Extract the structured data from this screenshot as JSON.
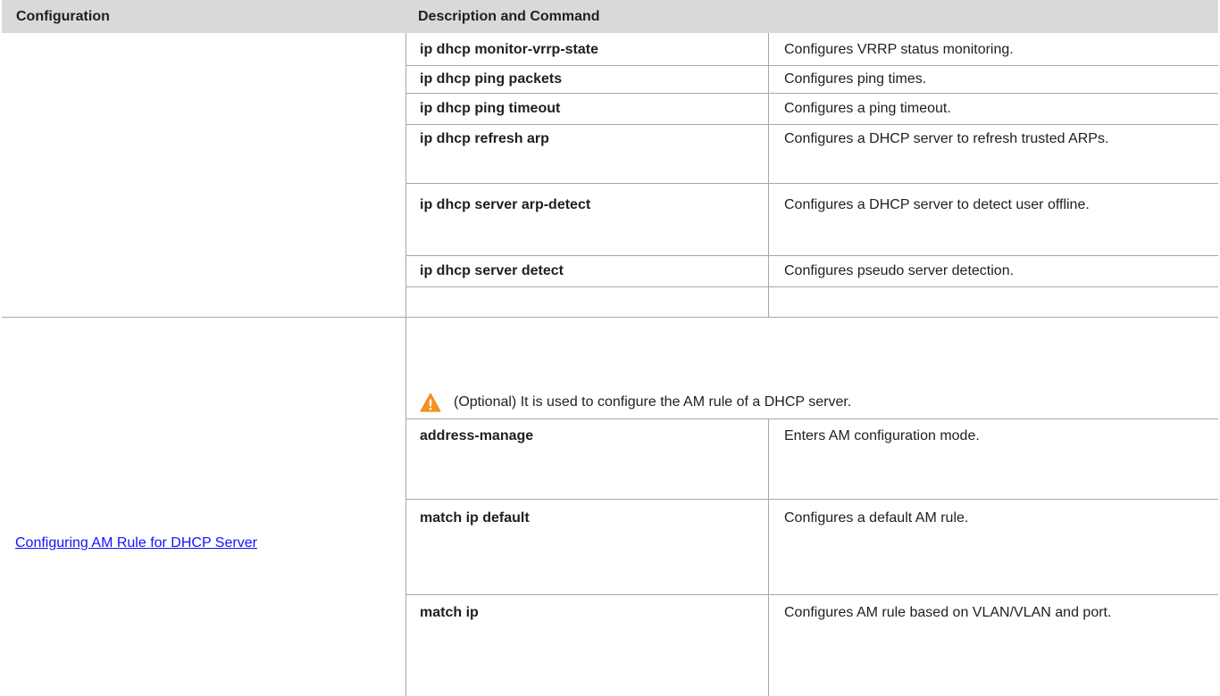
{
  "header": {
    "configuration": "Configuration",
    "description_and_command": "Description and Command"
  },
  "section1": {
    "rows": [
      {
        "command": "ip dhcp monitor-vrrp-state",
        "description": "Configures VRRP status monitoring."
      },
      {
        "command": "ip dhcp ping packets",
        "description": "Configures ping times."
      },
      {
        "command": "ip dhcp ping timeout",
        "description": "Configures a ping timeout."
      },
      {
        "command": "ip dhcp refresh arp",
        "description": "Configures a DHCP server to refresh trusted ARPs."
      },
      {
        "command": "ip dhcp server arp-detect",
        "description": "Configures a DHCP server to detect user offline."
      },
      {
        "command": "ip dhcp server detect",
        "description": "Configures pseudo server detection."
      }
    ]
  },
  "section2": {
    "configuration_link": "Configuring AM Rule for DHCP Server",
    "note_icon": "warning-triangle-icon",
    "note_text": "(Optional) It is used to configure the AM rule of a DHCP server.",
    "rows": [
      {
        "command": "address-manage",
        "description": "Enters AM configuration mode."
      },
      {
        "command": "match ip default",
        "description": "Configures a default AM rule."
      },
      {
        "command": "match ip",
        "description": "Configures AM rule based on VLAN/VLAN and port."
      }
    ]
  },
  "colors": {
    "header_bg": "#d9d9d9",
    "grid": "#a6a6a6",
    "link": "#1a0dff",
    "warning": "#f7941d"
  }
}
